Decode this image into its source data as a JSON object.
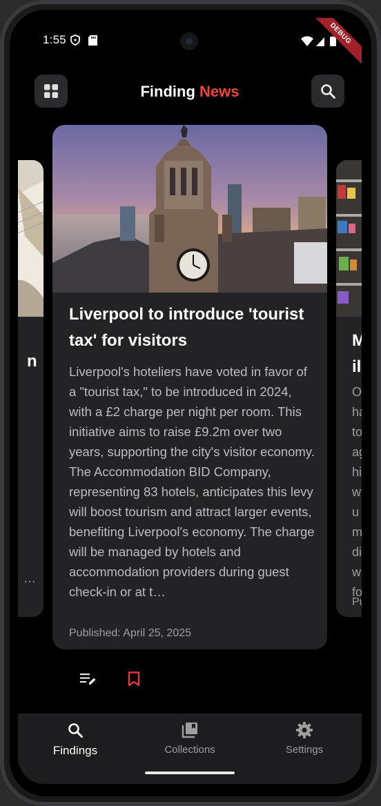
{
  "status_bar": {
    "time": "1:55",
    "debug_label": "DEBUG"
  },
  "app_bar": {
    "title_part1": "Finding",
    "title_part2": "News",
    "accent_color": "#f04438"
  },
  "main_card": {
    "title": "Liverpool to introduce 'tourist tax' for visitors",
    "body": "Liverpool's hoteliers have voted in favor of a \"tourist tax,\" to be introduced in 2024, with a £2 charge per night per room. This initiative aims to raise £9.2m over two years, supporting the city's visitor economy. The Accommodation BID Company, representing 83 hotels, anticipates this levy will boost tourism and attract larger events, benefiting Liverpool's economy. The charge will be managed by hotels and accommodation providers during guest check-in or at t…",
    "published": "Published: April 25, 2025"
  },
  "left_card": {
    "title_fragment": "n",
    "ellipsis": "…"
  },
  "right_card": {
    "title_fragment_1": "M",
    "title_fragment_2": "il",
    "body_fragments": [
      "O",
      "ha",
      "to",
      "ag",
      "hi",
      "w",
      "u",
      "m",
      "di",
      "w",
      "fo"
    ],
    "published_fragment": "Pu"
  },
  "bottom_nav": {
    "items": [
      {
        "label": "Findings",
        "icon": "search-icon",
        "active": true
      },
      {
        "label": "Collections",
        "icon": "collections-icon",
        "active": false
      },
      {
        "label": "Settings",
        "icon": "gear-icon",
        "active": false
      }
    ]
  }
}
